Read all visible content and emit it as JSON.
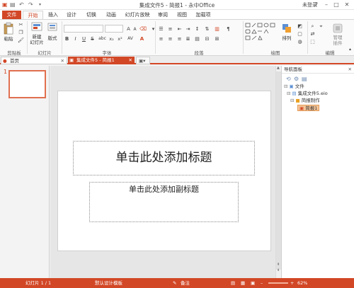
{
  "titlebar": {
    "title": "集成文件5 - 简报1 - 永中Office",
    "login": "未登录",
    "min": "–",
    "max": "□",
    "close": "✕",
    "help": "?"
  },
  "menu": {
    "tabs": [
      "文件",
      "开始",
      "插入",
      "设计",
      "切换",
      "动画",
      "幻灯片放映",
      "审阅",
      "视图",
      "加载项"
    ],
    "active": "开始"
  },
  "ribbon": {
    "paste": "粘贴",
    "new_slide": "新建\n幻灯片",
    "layout": "版式",
    "arrange": "排列",
    "manage": "管理\n插件",
    "groups": [
      "剪贴板",
      "幻灯片",
      "字体",
      "段落",
      "绘图",
      "编辑"
    ],
    "font_size_dd": "▾",
    "font_grow": "A",
    "font_shrink": "A",
    "bold": "B",
    "italic": "I",
    "underline": "U",
    "strike": "S",
    "shadow": "abc",
    "sub": "x₂",
    "sup": "x²",
    "spacing": "AV",
    "font_color": "A"
  },
  "doc_tabs": [
    {
      "label": "首页"
    },
    {
      "label": "集成文件5 - 简报1"
    }
  ],
  "slide": {
    "number": "1",
    "title_placeholder": "单击此处添加标题",
    "subtitle_placeholder": "单击此处添加副标题"
  },
  "nav": {
    "header": "导航面板",
    "close": "✕",
    "root": "文件",
    "file": "集成文件5.eio",
    "folder": "简报制作",
    "doc": "简报1"
  },
  "status": {
    "slide_count": "幻灯片 1 / 1",
    "template": "默认设计模板",
    "notes": "备注",
    "zoom": "62%"
  },
  "colors": {
    "accent": "#d24726",
    "folder": "#e8a020"
  }
}
